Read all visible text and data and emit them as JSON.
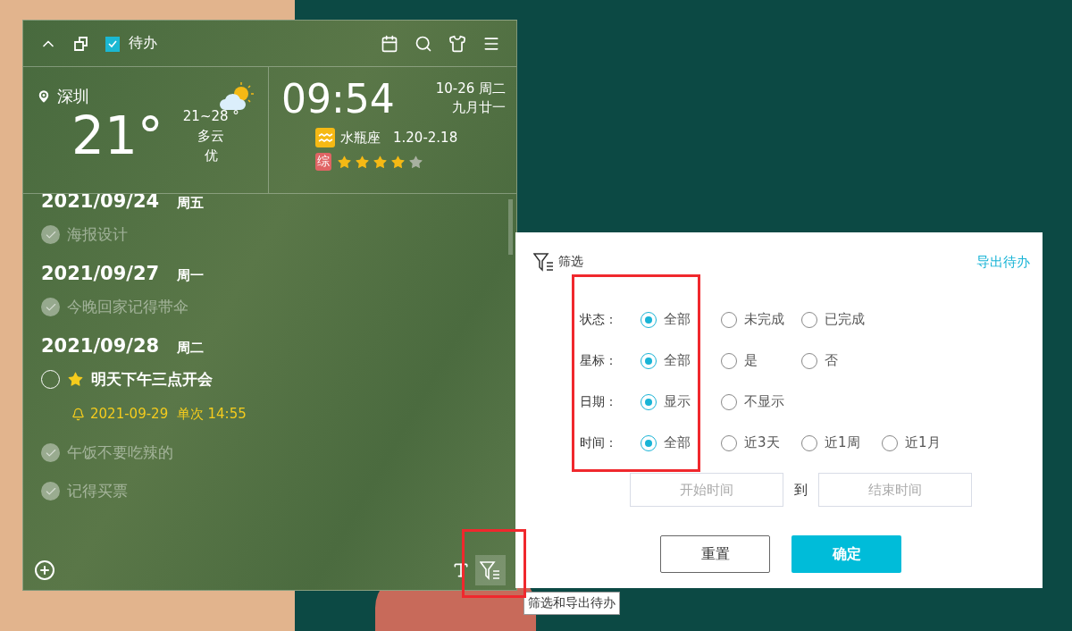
{
  "widget": {
    "title": "待办"
  },
  "weather": {
    "city": "深圳",
    "temperature": "21°",
    "range": "21~28 °",
    "condition": "多云",
    "air_quality": "优"
  },
  "clock": {
    "time": "09:54",
    "date": "10-26 周二",
    "lunar": "九月廿一",
    "zodiac": "水瓶座",
    "zodiac_range": "1.20-2.18",
    "rating_badge": "综",
    "stars": 4
  },
  "days": [
    {
      "date": "2021/09/24",
      "weekday": "周五",
      "todos": [
        {
          "text": "海报设计",
          "done": true,
          "starred": false
        }
      ]
    },
    {
      "date": "2021/09/27",
      "weekday": "周一",
      "todos": [
        {
          "text": "今晚回家记得带伞",
          "done": true,
          "starred": false
        }
      ]
    },
    {
      "date": "2021/09/28",
      "weekday": "周二",
      "todos": [
        {
          "text": "明天下午三点开会",
          "done": false,
          "starred": true,
          "reminder": {
            "date": "2021-09-29",
            "repeat": "单次",
            "time": "14:55"
          }
        },
        {
          "text": "午饭不要吃辣的",
          "done": true,
          "starred": false
        },
        {
          "text": "记得买票",
          "done": true,
          "starred": false
        }
      ]
    }
  ],
  "filter_panel": {
    "title": "筛选",
    "export_link": "导出待办",
    "groups": [
      {
        "label": "状态：",
        "options": [
          {
            "label": "全部",
            "selected": true
          },
          {
            "label": "未完成",
            "selected": false
          },
          {
            "label": "已完成",
            "selected": false
          }
        ]
      },
      {
        "label": "星标：",
        "options": [
          {
            "label": "全部",
            "selected": true
          },
          {
            "label": "是",
            "selected": false
          },
          {
            "label": "否",
            "selected": false
          }
        ]
      },
      {
        "label": "日期：",
        "options": [
          {
            "label": "显示",
            "selected": true
          },
          {
            "label": "不显示",
            "selected": false
          }
        ]
      },
      {
        "label": "时间：",
        "options": [
          {
            "label": "全部",
            "selected": true
          },
          {
            "label": "近3天",
            "selected": false
          },
          {
            "label": "近1周",
            "selected": false
          },
          {
            "label": "近1月",
            "selected": false
          }
        ]
      }
    ],
    "start_placeholder": "开始时间",
    "range_separator": "到",
    "end_placeholder": "结束时间",
    "buttons": [
      {
        "label": "重置",
        "kind": "secondary"
      },
      {
        "label": "确定",
        "kind": "primary"
      }
    ]
  },
  "tooltip": "筛选和导出待办"
}
